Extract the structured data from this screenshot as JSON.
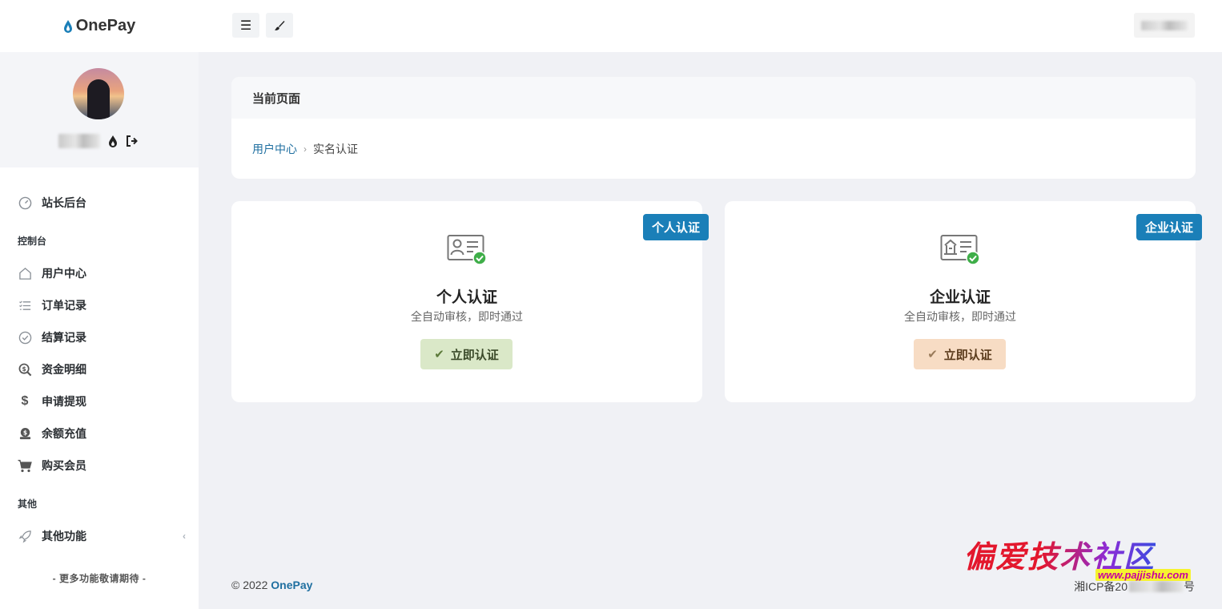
{
  "brand": {
    "name": "OnePay"
  },
  "topbar": {
    "menu_icon": "hamburger-icon",
    "theme_icon": "brush-icon"
  },
  "sidebar": {
    "dashboard": {
      "label": "站长后台",
      "icon": "dashboard-icon"
    },
    "sections": [
      {
        "heading": "控制台",
        "items": [
          {
            "label": "用户中心",
            "icon": "home-icon"
          },
          {
            "label": "订单记录",
            "icon": "list-icon"
          },
          {
            "label": "结算记录",
            "icon": "check-circle-icon"
          },
          {
            "label": "资金明细",
            "icon": "search-dollar-icon"
          },
          {
            "label": "申请提现",
            "icon": "dollar-icon"
          },
          {
            "label": "余额充值",
            "icon": "coins-icon"
          },
          {
            "label": "购买会员",
            "icon": "cart-icon"
          }
        ]
      },
      {
        "heading": "其他",
        "items": [
          {
            "label": "其他功能",
            "icon": "rocket-icon"
          }
        ]
      }
    ],
    "more_text": "- 更多功能敬请期待 -"
  },
  "breadcrumb": {
    "header": "当前页面",
    "parent": "用户中心",
    "current": "实名认证"
  },
  "cards": [
    {
      "badge": "个人认证",
      "title": "个人认证",
      "subtitle": "全自动审核，即时通过",
      "button": "立即认证",
      "icon": "id-card-person-icon"
    },
    {
      "badge": "企业认证",
      "title": "企业认证",
      "subtitle": "全自动审核，即时通过",
      "button": "立即认证",
      "icon": "id-card-company-icon"
    }
  ],
  "footer": {
    "copyright": "© 2022 ",
    "brand": "OnePay",
    "icp_prefix": "湘ICP备20",
    "icp_suffix": "号"
  },
  "watermark": {
    "title": "偏爱技术社区",
    "url": "www.pajjishu.com"
  },
  "colors": {
    "accent": "#1a7fb8",
    "link": "#1f6fa0",
    "success": "#3fae49"
  }
}
